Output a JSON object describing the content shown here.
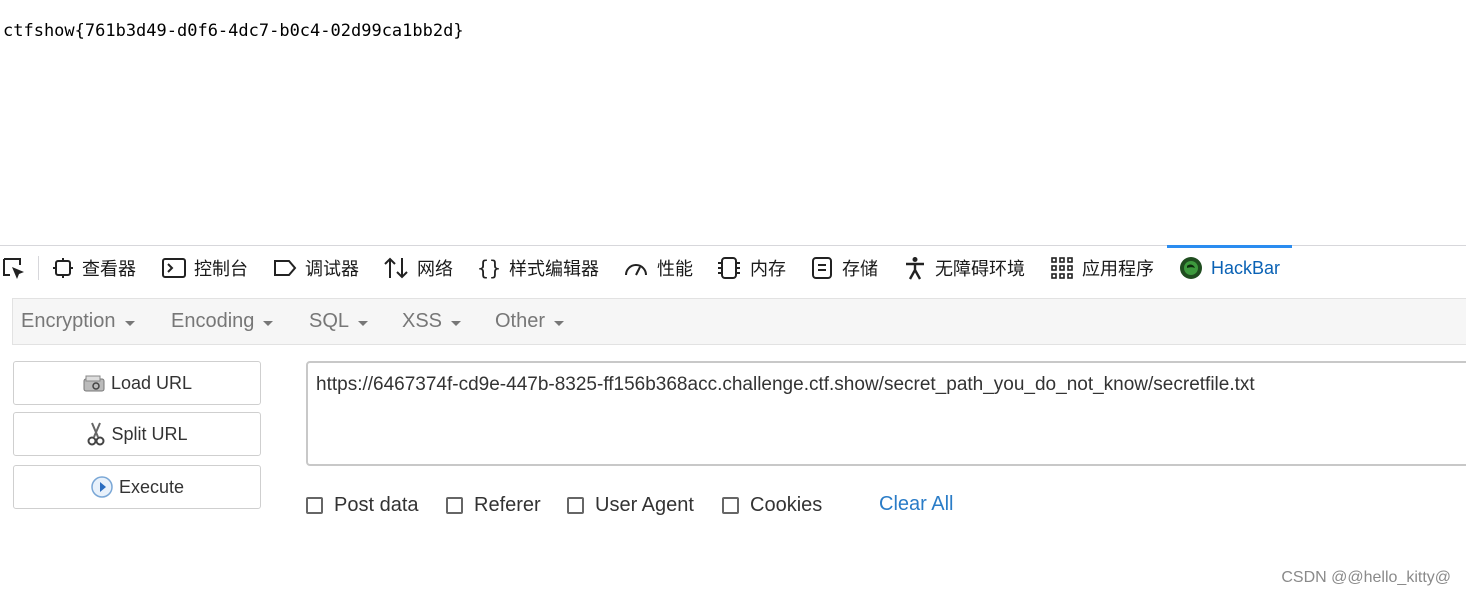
{
  "page": {
    "flag_text": "ctfshow{761b3d49-d0f6-4dc7-b0c4-02d99ca1bb2d}"
  },
  "devtools": {
    "tabs": [
      {
        "label": "查看器",
        "icon": "inspector-icon"
      },
      {
        "label": "控制台",
        "icon": "console-icon"
      },
      {
        "label": "调试器",
        "icon": "debugger-icon"
      },
      {
        "label": "网络",
        "icon": "network-icon"
      },
      {
        "label": "样式编辑器",
        "icon": "style-editor-icon"
      },
      {
        "label": "性能",
        "icon": "performance-icon"
      },
      {
        "label": "内存",
        "icon": "memory-icon"
      },
      {
        "label": "存储",
        "icon": "storage-icon"
      },
      {
        "label": "无障碍环境",
        "icon": "accessibility-icon"
      },
      {
        "label": "应用程序",
        "icon": "application-icon"
      },
      {
        "label": "HackBar",
        "icon": "hackbar-icon",
        "active": true
      }
    ]
  },
  "hackbar": {
    "menus": [
      "Encryption",
      "Encoding",
      "SQL",
      "XSS",
      "Other"
    ],
    "buttons": {
      "load_url": "Load URL",
      "split_url": "Split URL",
      "execute": "Execute"
    },
    "url_value": "https://6467374f-cd9e-447b-8325-ff156b368acc.challenge.ctf.show/secret_path_you_do_not_know/secretfile.txt",
    "options": [
      {
        "label": "Post data",
        "checked": false
      },
      {
        "label": "Referer",
        "checked": false
      },
      {
        "label": "User Agent",
        "checked": false
      },
      {
        "label": "Cookies",
        "checked": false
      }
    ],
    "clear_all": "Clear All"
  },
  "watermark": "CSDN @@hello_kitty@",
  "colors": {
    "accent": "#2a8cf0",
    "active_tab_text": "#0a62b5",
    "link": "#2a7cc7"
  }
}
